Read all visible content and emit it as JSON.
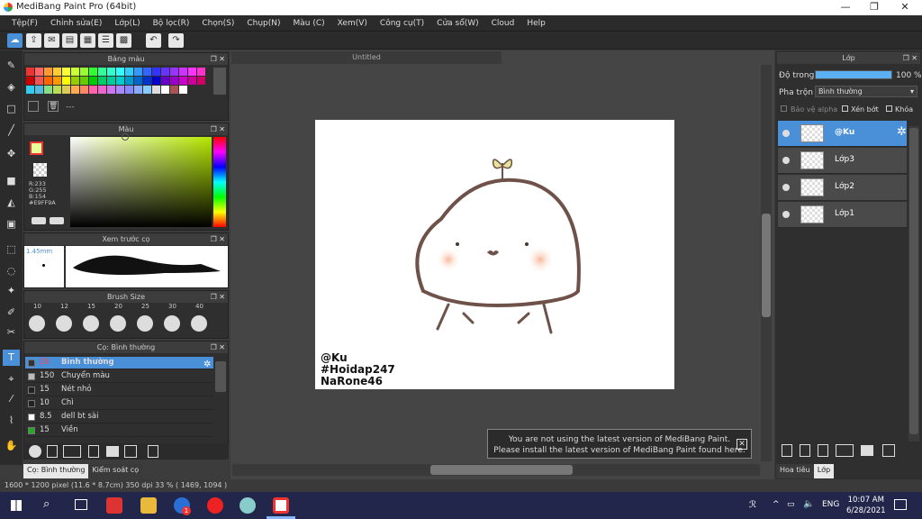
{
  "window": {
    "title": "MediBang Paint Pro (64bit)",
    "min": "—",
    "max": "❐",
    "close": "✕"
  },
  "menu": [
    "Tệp(F)",
    "Chỉnh sửa(E)",
    "Lớp(L)",
    "Bộ lọc(R)",
    "Chọn(S)",
    "Chụp(N)",
    "Màu (C)",
    "Xem(V)",
    "Công cụ(T)",
    "Cửa sổ(W)",
    "Cloud",
    "Help"
  ],
  "panels": {
    "palette": {
      "title": "Bảng màu",
      "bottom": "---"
    },
    "color": {
      "title": "Màu",
      "r": "R:233",
      "g": "G:255",
      "b": "B:154",
      "hex": "#E9FF9A"
    },
    "preview": {
      "title": "Xem trước cọ",
      "size": "1.45mm"
    },
    "brushsize": {
      "title": "Brush Size",
      "sizes": [
        "10",
        "12",
        "15",
        "20",
        "25",
        "30",
        "40"
      ]
    },
    "brush": {
      "title": "Cọ: Bình thường",
      "items": [
        {
          "size": "20",
          "name": "Bình thường",
          "color": "#333333"
        },
        {
          "size": "150",
          "name": "Chuyển màu",
          "color": "#bbbbbb"
        },
        {
          "size": "15",
          "name": "Nét nhỏ",
          "color": "#222222"
        },
        {
          "size": "10",
          "name": "Chì",
          "color": "#222222"
        },
        {
          "size": "8.5",
          "name": "dell bt sài",
          "color": "#ffffff"
        },
        {
          "size": "15",
          "name": "Viền",
          "color": "#22aa22"
        }
      ]
    },
    "lefttabs": [
      "Cọ: Bình thường",
      "Kiểm soát cọ"
    ]
  },
  "canvas": {
    "tab": "Untitled",
    "watermark": [
      "@Ku",
      "#Hoidap247",
      "NaRone46"
    ]
  },
  "notice": {
    "line1": "You are not using the latest version of MediBang Paint.",
    "line2": "Please install the latest version of MediBang Paint found here.",
    "close": "✕"
  },
  "layers": {
    "title": "Lớp",
    "opacity_label": "Độ trong",
    "opacity_value": "100 %",
    "opacity": 1.0,
    "blend_label": "Pha trộn",
    "blend_value": "Bình thường",
    "protect_alpha": "Bảo vệ alpha",
    "clip": "Xén bớt",
    "lock": "Khóa",
    "items": [
      "@Ku",
      "Lớp3",
      "Lớp2",
      "Lớp1"
    ],
    "tabs": [
      "Hoa tiêu",
      "Lớp"
    ]
  },
  "status": "1600 * 1200 pixel   (11.6 * 8.7cm)   350 dpi   33 %   ( 1469, 1094 )",
  "taskbar": {
    "lang": "ENG",
    "time": "10:07 AM",
    "date": "6/28/2021",
    "notif": "1"
  },
  "colors": {
    "accent": "#4a90d9",
    "fg": "#E9FF9A"
  }
}
